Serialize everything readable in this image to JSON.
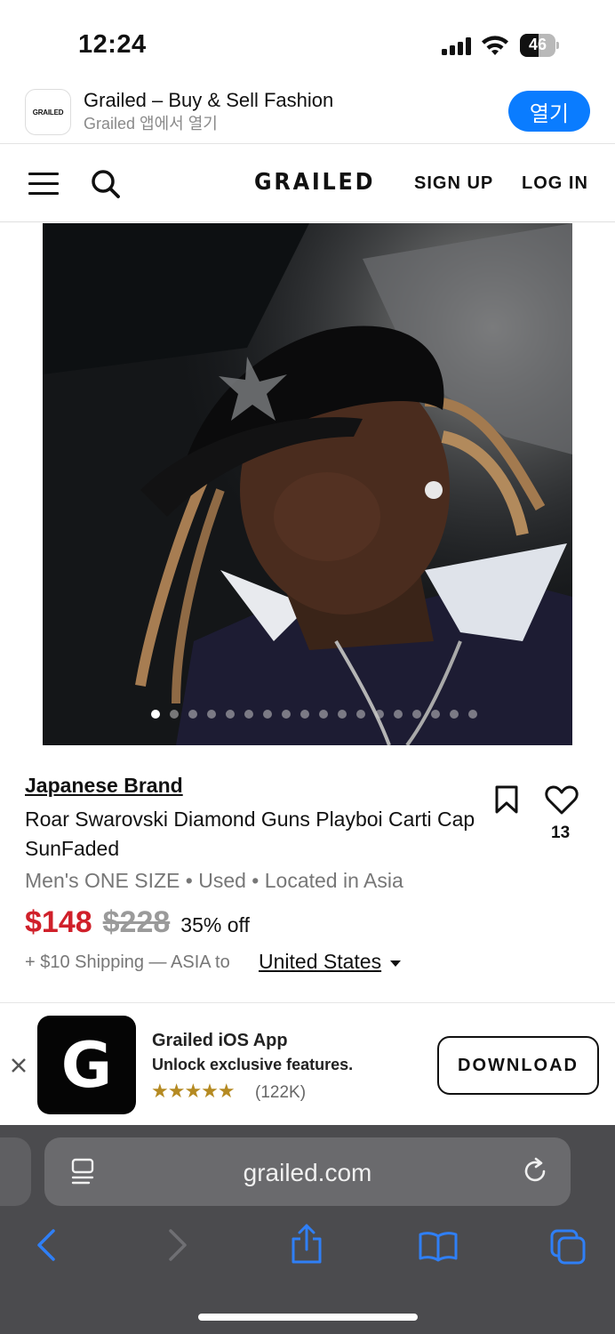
{
  "status_bar": {
    "time": "12:24",
    "battery": "46"
  },
  "smart_banner": {
    "logo_text": "GRAILED",
    "title": "Grailed – Buy & Sell Fashion",
    "subtitle": "Grailed 앱에서 열기",
    "open_label": "열기"
  },
  "header": {
    "logo": "GRAILED",
    "signup": "SIGN UP",
    "login": "LOG IN"
  },
  "gallery": {
    "image_count": 18,
    "active_index": 0
  },
  "product": {
    "brand": "Japanese Brand",
    "title": "Roar Swarovski Diamond Guns Playboi Carti Cap SunFaded",
    "likes": "13",
    "meta": "Men's ONE SIZE • Used • Located in Asia",
    "price": "$148",
    "old_price": "$228",
    "discount": "35% off",
    "shipping": "+ $10 Shipping — ASIA to",
    "destination": "United States"
  },
  "app_promo": {
    "logo_letter": "G",
    "title": "Grailed iOS App",
    "subtitle": "Unlock exclusive features.",
    "stars": "★★★★★",
    "rating_count": "(122K)",
    "download_label": "DOWNLOAD"
  },
  "browser": {
    "url": "grailed.com"
  },
  "colors": {
    "accent": "#0a7cff",
    "price_red": "#d0202a",
    "toolbar_blue": "#2f7ff6",
    "star_gold": "#b58a22"
  }
}
